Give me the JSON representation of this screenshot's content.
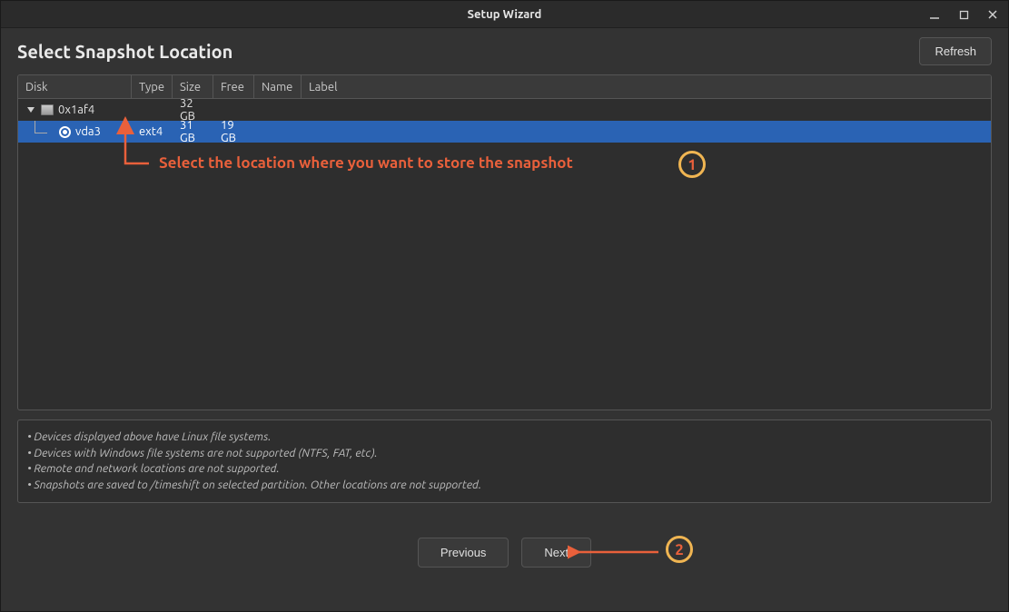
{
  "titlebar": {
    "title": "Setup Wizard"
  },
  "page": {
    "title": "Select Snapshot Location"
  },
  "buttons": {
    "refresh": "Refresh",
    "previous": "Previous",
    "next": "Next"
  },
  "table": {
    "headers": {
      "disk": "Disk",
      "type": "Type",
      "size": "Size",
      "free": "Free",
      "name": "Name",
      "label": "Label"
    },
    "rows": [
      {
        "kind": "parent",
        "disk": "0x1af4",
        "type": "",
        "size": "32 GB",
        "free": "",
        "name": "",
        "label": ""
      },
      {
        "kind": "child",
        "selected": true,
        "disk": "vda3",
        "type": "ext4",
        "size": "31 GB",
        "free": "19 GB",
        "name": "",
        "label": ""
      }
    ]
  },
  "notes": [
    "Devices displayed above have Linux file systems.",
    "Devices with Windows file systems are not supported (NTFS, FAT, etc).",
    "Remote and network locations are not supported.",
    "Snapshots are saved to /timeshift on selected partition. Other locations are not supported."
  ],
  "annotations": {
    "a1_text": "Select the location where you want to store the snapshot",
    "a1_num": "1",
    "a2_num": "2"
  }
}
